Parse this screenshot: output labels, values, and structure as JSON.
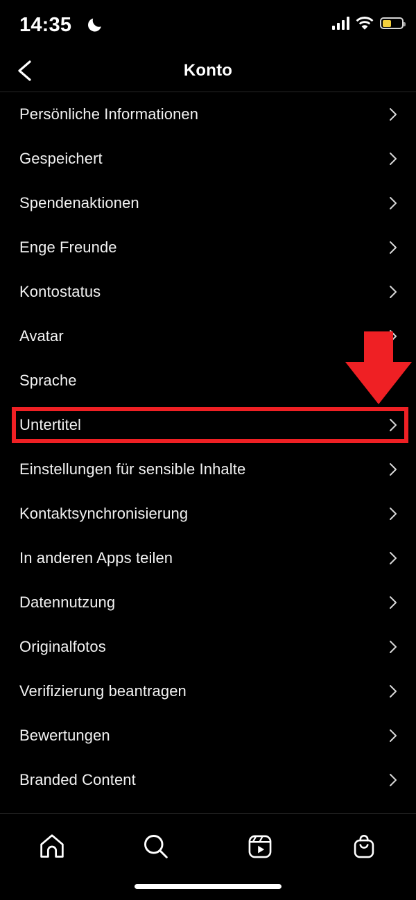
{
  "status_bar": {
    "time": "14:35",
    "moon_icon": "moon-dnd-icon",
    "signal_icon": "cellular-signal-icon",
    "wifi_icon": "wifi-icon",
    "battery_icon": "battery-low-power-icon",
    "battery_level_percent": 45,
    "battery_color": "#f5d13c"
  },
  "header": {
    "back_icon": "chevron-left-icon",
    "title": "Konto"
  },
  "list": {
    "chevron_icon": "chevron-right-icon",
    "items": [
      {
        "label": "Persönliche Informationen"
      },
      {
        "label": "Gespeichert"
      },
      {
        "label": "Spendenaktionen"
      },
      {
        "label": "Enge Freunde"
      },
      {
        "label": "Kontostatus"
      },
      {
        "label": "Avatar"
      },
      {
        "label": "Sprache"
      },
      {
        "label": "Untertitel"
      },
      {
        "label": "Einstellungen für sensible Inhalte"
      },
      {
        "label": "Kontaktsynchronisierung"
      },
      {
        "label": "In anderen Apps teilen"
      },
      {
        "label": "Datennutzung"
      },
      {
        "label": "Originalfotos"
      },
      {
        "label": "Verifizierung beantragen"
      },
      {
        "label": "Bewertungen"
      },
      {
        "label": "Branded Content"
      }
    ]
  },
  "annotation": {
    "highlighted_item": "Untertitel",
    "highlight_color": "#ef2024",
    "arrow_icon": "red-down-arrow-annotation",
    "arrow_color": "#ef2024"
  },
  "tab_bar": {
    "tabs": [
      {
        "icon": "home-icon",
        "label": "Home"
      },
      {
        "icon": "search-icon",
        "label": "Suche"
      },
      {
        "icon": "reels-icon",
        "label": "Reels"
      },
      {
        "icon": "shop-bag-icon",
        "label": "Shop"
      }
    ],
    "home_indicator": "home-indicator"
  }
}
